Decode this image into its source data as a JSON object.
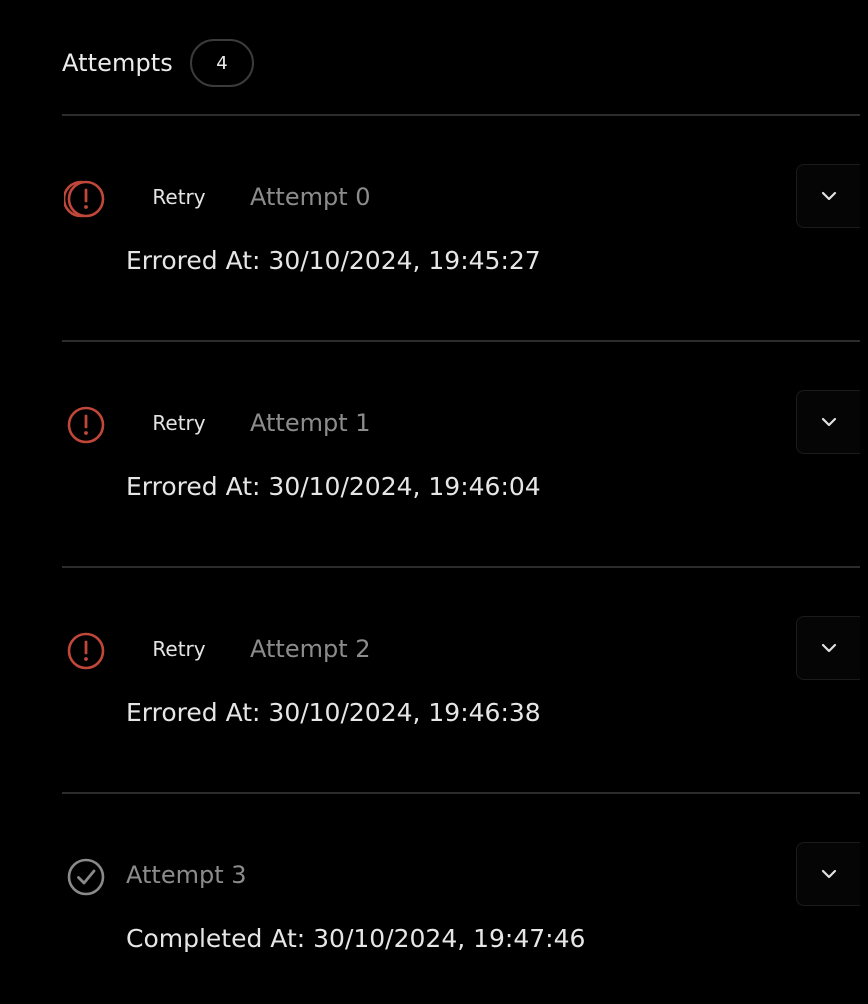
{
  "header": {
    "title": "Attempts",
    "count": "4"
  },
  "colors": {
    "error": "#c0473a",
    "success": "#8a8a8a",
    "divider": "#2c2c2c"
  },
  "attempts": [
    {
      "status": "error",
      "icon": "error-circle-exclamation-icon",
      "retry_label": "Retry",
      "label": "Attempt 0",
      "timestamp": "Errored At: 30/10/2024, 19:45:27",
      "expand_icon": "chevron-down-icon"
    },
    {
      "status": "error",
      "icon": "error-circle-exclamation-icon",
      "retry_label": "Retry",
      "label": "Attempt 1",
      "timestamp": "Errored At: 30/10/2024, 19:46:04",
      "expand_icon": "chevron-down-icon"
    },
    {
      "status": "error",
      "icon": "error-circle-exclamation-icon",
      "retry_label": "Retry",
      "label": "Attempt 2",
      "timestamp": "Errored At: 30/10/2024, 19:46:38",
      "expand_icon": "chevron-down-icon"
    },
    {
      "status": "completed",
      "icon": "check-circle-icon",
      "label": "Attempt 3",
      "timestamp": "Completed At: 30/10/2024, 19:47:46",
      "expand_icon": "chevron-down-icon"
    }
  ]
}
